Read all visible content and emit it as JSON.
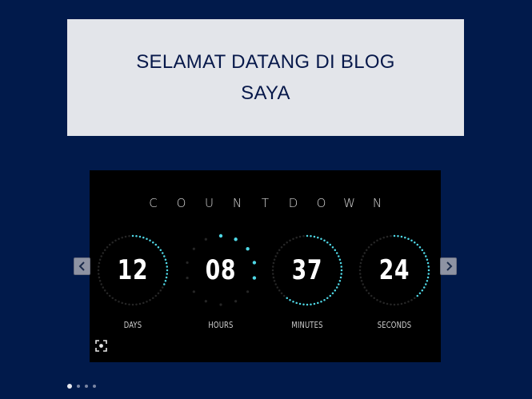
{
  "banner": {
    "line1": "SELAMAT DATANG DI BLOG",
    "line2": "SAYA"
  },
  "countdown": {
    "title_letters": [
      "C",
      "O",
      "U",
      "N",
      "T",
      "D",
      "O",
      "W",
      "N"
    ],
    "units": [
      {
        "value": "12",
        "label": "DAYS",
        "progress": 0.33
      },
      {
        "value": "08",
        "label": "HOURS",
        "progress": 0.33
      },
      {
        "value": "37",
        "label": "MINUTES",
        "progress": 0.62
      },
      {
        "value": "24",
        "label": "SECONDS",
        "progress": 0.4
      }
    ],
    "accent_color": "#4fd8e6",
    "dim_color": "#262626"
  },
  "slider": {
    "prev_icon": "chevron-left-icon",
    "next_icon": "chevron-right-icon",
    "zoom_icon": "fullscreen-icon",
    "slide_count": 4,
    "active_slide": 1
  }
}
